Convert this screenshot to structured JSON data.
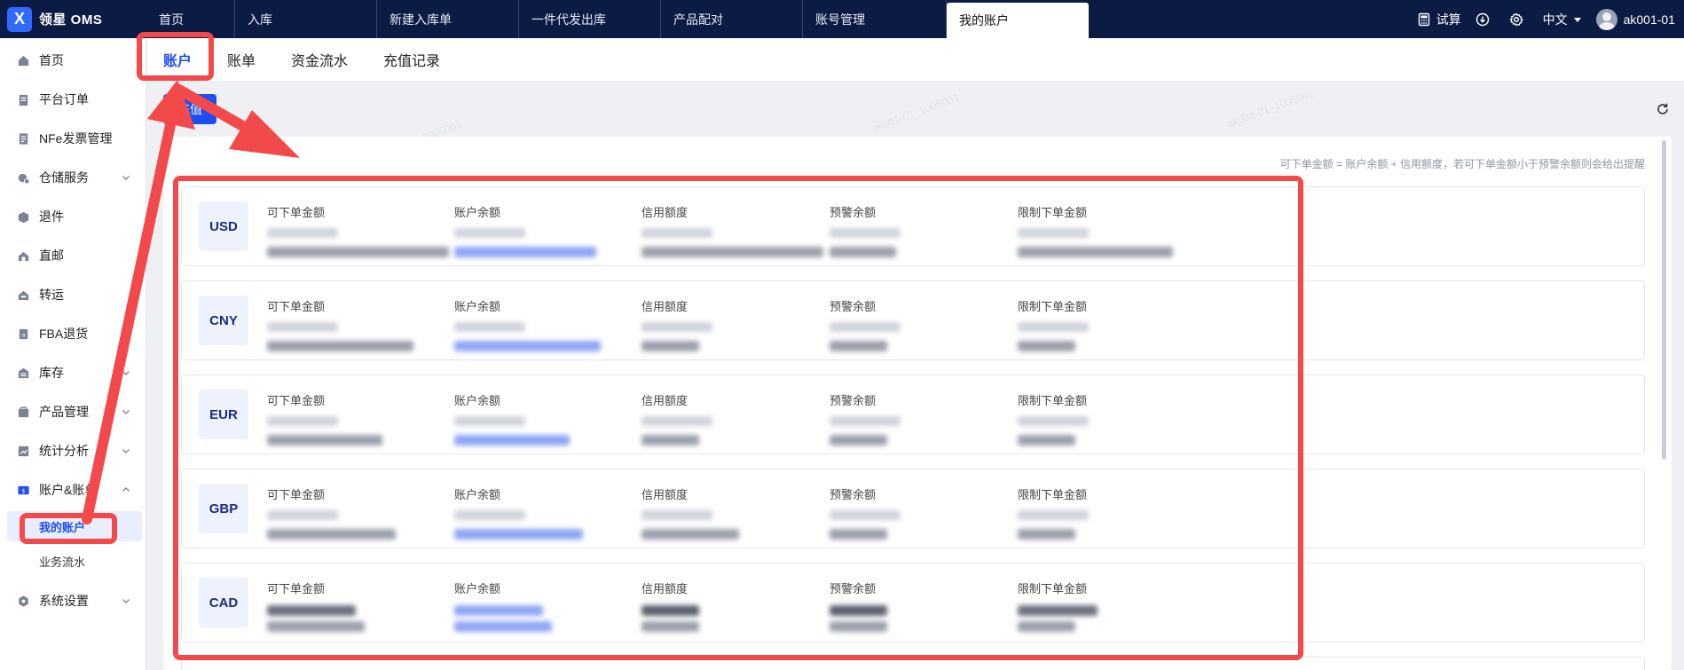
{
  "app": {
    "logo_text": "领星 OMS",
    "logo_glyph": "X"
  },
  "top_nav": {
    "tabs": [
      {
        "label": "首页"
      },
      {
        "label": "入库"
      },
      {
        "label": "新建入库单"
      },
      {
        "label": "一件代发出库"
      },
      {
        "label": "产品配对"
      },
      {
        "label": "账号管理"
      },
      {
        "label": "我的账户",
        "active": true
      }
    ],
    "trial_label": "试算",
    "language": "中文",
    "user": "ak001-01"
  },
  "sidebar": {
    "items": [
      {
        "label": "首页",
        "icon": "home-icon"
      },
      {
        "label": "平台订单",
        "icon": "clipboard-icon"
      },
      {
        "label": "NFe发票管理",
        "icon": "invoice-icon"
      },
      {
        "label": "仓储服务",
        "icon": "warehouse-service-icon",
        "expandable": true
      },
      {
        "label": "退件",
        "icon": "return-box-icon"
      },
      {
        "label": "直邮",
        "icon": "direct-mail-icon"
      },
      {
        "label": "转运",
        "icon": "transship-icon"
      },
      {
        "label": "FBA退货",
        "icon": "fba-return-icon"
      },
      {
        "label": "库存",
        "icon": "inventory-icon",
        "expandable": true
      },
      {
        "label": "产品管理",
        "icon": "product-icon",
        "expandable": true
      },
      {
        "label": "统计分析",
        "icon": "stats-icon",
        "expandable": true
      },
      {
        "label": "账户&账单",
        "icon": "account-icon",
        "expandable": true,
        "expanded": true
      },
      {
        "label": "系统设置",
        "icon": "settings-icon",
        "expandable": true
      }
    ],
    "sub_items": [
      {
        "label": "我的账户",
        "active": true
      },
      {
        "label": "业务流水"
      }
    ]
  },
  "sub_tabs": [
    {
      "label": "账户",
      "active": true
    },
    {
      "label": "账单"
    },
    {
      "label": "资金流水"
    },
    {
      "label": "充值记录"
    }
  ],
  "recharge_button": "充值",
  "hint_text": "可下单金额 = 账户余额 + 信用额度，若可下单金额小于预警余额则会给出提醒",
  "columns": [
    "可下单金额",
    "账户余额",
    "信用额度",
    "预警余额",
    "限制下单金额"
  ],
  "currencies": [
    "USD",
    "CNY",
    "EUR",
    "GBP",
    "CAD"
  ],
  "watermark": "ak001-01_1005001",
  "colors": {
    "brand_blue": "#1e4df0",
    "topbar": "#0c1b44",
    "annotation_red": "#f24a4a"
  }
}
